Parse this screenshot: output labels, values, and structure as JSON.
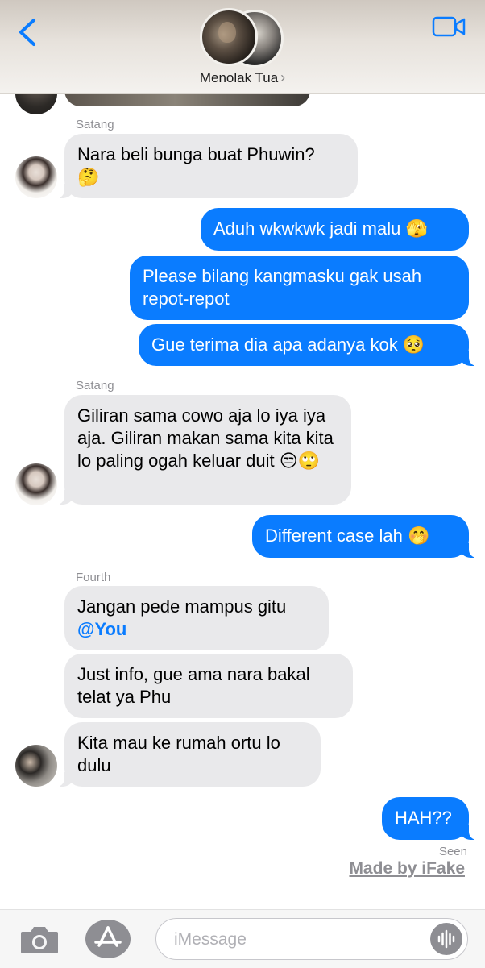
{
  "header": {
    "back_icon": "chevron-left-icon",
    "video_icon": "video-camera-icon",
    "chat_name": "Menolak Tua",
    "chevron": "›",
    "accent_color": "#0a7cff"
  },
  "messages": [
    {
      "type": "sender",
      "text": "Satang"
    },
    {
      "type": "incoming",
      "sender": "Satang",
      "text": "Nara beli bunga buat Phuwin?",
      "emoji": "🤔"
    },
    {
      "type": "outgoing",
      "text": "Aduh wkwkwk jadi malu",
      "emoji": "🫣"
    },
    {
      "type": "outgoing",
      "text": "Please bilang kangmasku gak usah repot-repot"
    },
    {
      "type": "outgoing",
      "text": "Gue terima dia apa adanya kok",
      "emoji": "🥺"
    },
    {
      "type": "sender",
      "text": "Satang"
    },
    {
      "type": "incoming",
      "sender": "Satang",
      "text": "Giliran sama cowo aja lo iya iya aja. Giliran makan sama kita kita lo paling ogah keluar duit",
      "emoji": "😒🙄"
    },
    {
      "type": "outgoing",
      "text": "Different case lah",
      "emoji": "🤭"
    },
    {
      "type": "sender",
      "text": "Fourth"
    },
    {
      "type": "incoming",
      "sender": "Fourth",
      "text": "Jangan pede mampus gitu",
      "mention": "@You"
    },
    {
      "type": "incoming",
      "sender": "Fourth",
      "text": "Just info, gue ama nara bakal telat ya Phu"
    },
    {
      "type": "incoming",
      "sender": "Fourth",
      "text": "Kita mau ke rumah ortu lo dulu"
    },
    {
      "type": "outgoing",
      "text": "HAH??"
    }
  ],
  "status": {
    "seen": "Seen"
  },
  "watermark": "Made by iFake",
  "input_bar": {
    "camera_icon": "camera-icon",
    "apps_icon": "app-store-icon",
    "placeholder": "iMessage",
    "value": "",
    "audio_icon": "waveform-icon"
  }
}
